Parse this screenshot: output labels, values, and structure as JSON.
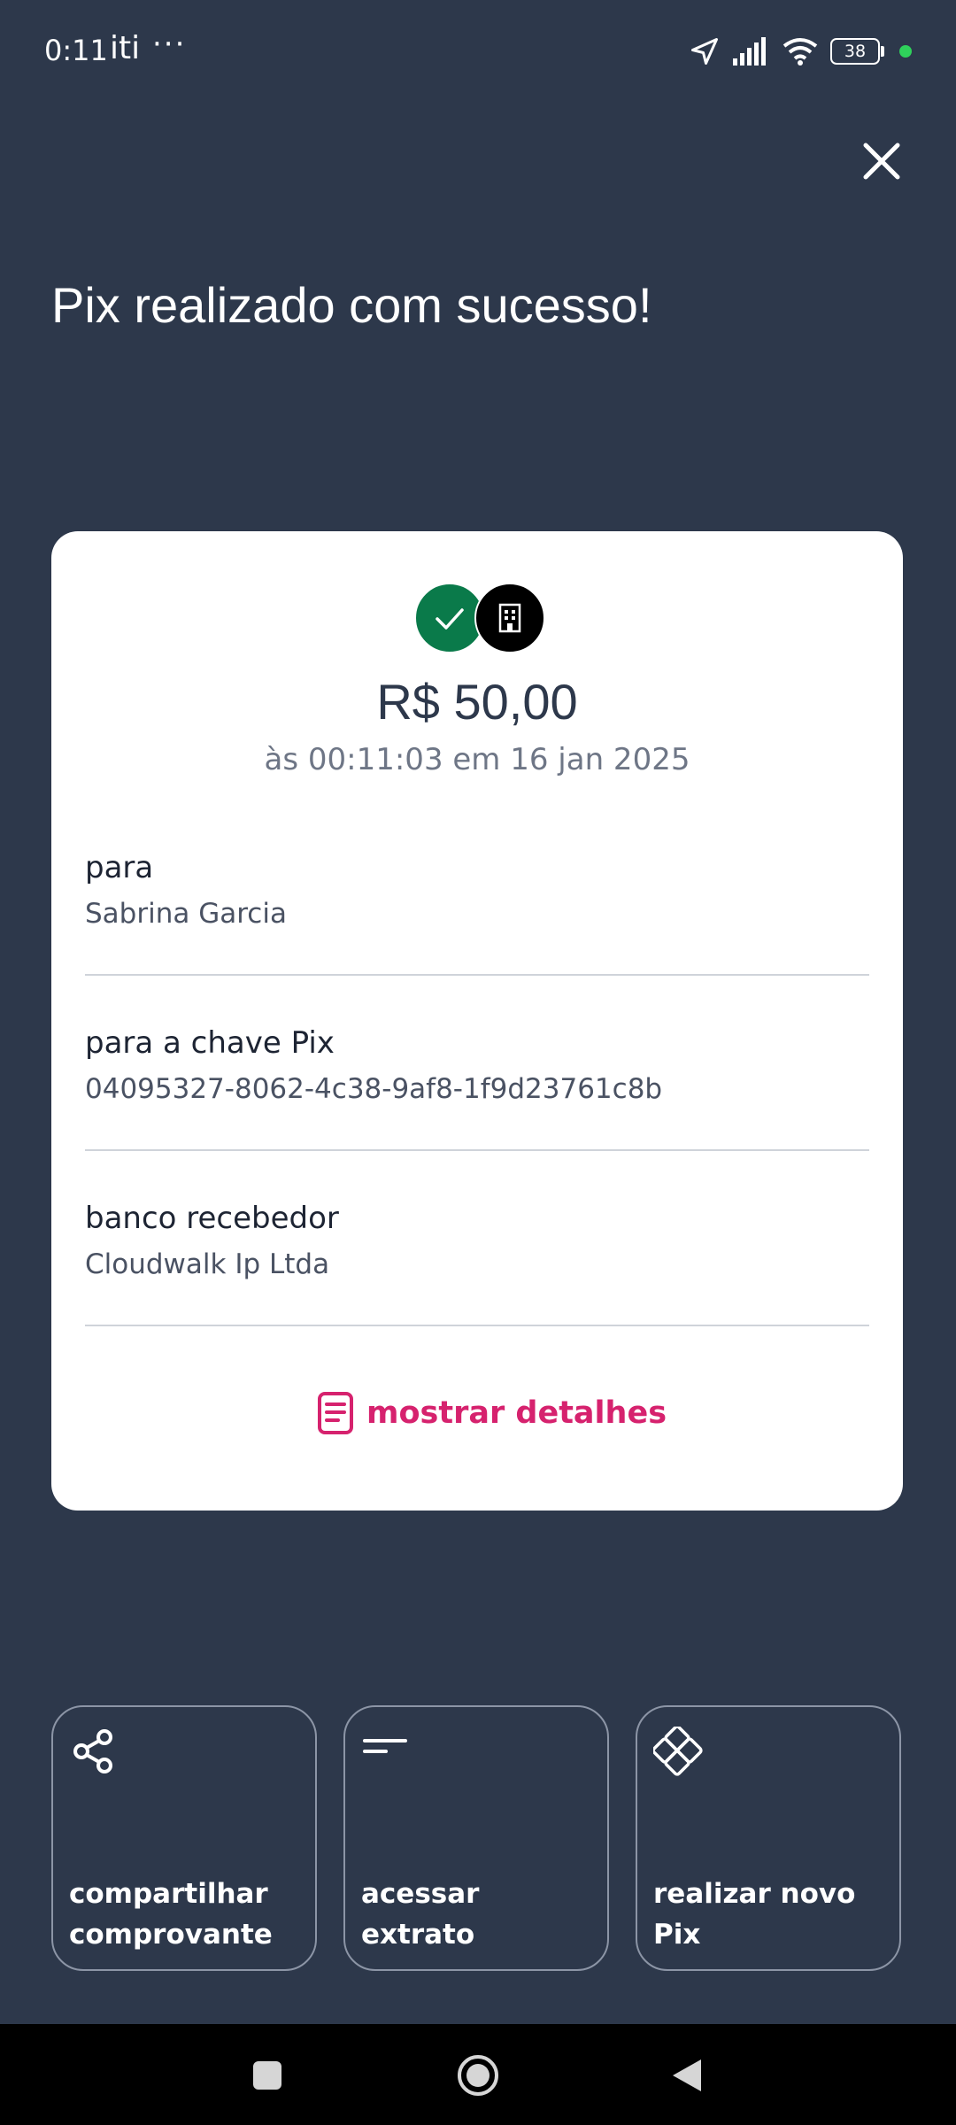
{
  "status_bar": {
    "time": "0:11",
    "app_label": "iti",
    "more_dots": "···",
    "battery_level": "38",
    "icons": [
      "location-arrow-icon",
      "signal-icon",
      "wifi-icon",
      "battery-icon",
      "green-dot-indicator"
    ]
  },
  "header": {
    "title": "Pix realizado com sucesso!",
    "close_icon": "close-icon"
  },
  "receipt": {
    "amount": "R$ 50,00",
    "datetime": "às 00:11:03 em 16 jan 2025",
    "details": [
      {
        "label": "para",
        "value": "Sabrina Garcia"
      },
      {
        "label": "para a chave Pix",
        "value": "04095327-8062-4c38-9af8-1f9d23761c8b"
      },
      {
        "label": "banco recebedor",
        "value": "Cloudwalk Ip Ltda"
      }
    ],
    "show_details_label": "mostrar detalhes"
  },
  "actions": [
    {
      "label": "compartilhar comprovante",
      "icon": "share-icon"
    },
    {
      "label": "acessar extrato",
      "icon": "statement-lines-icon"
    },
    {
      "label": "realizar novo Pix",
      "icon": "pix-icon"
    }
  ],
  "colors": {
    "background": "#2d384b",
    "card": "#ffffff",
    "accent": "#d6226e",
    "success": "#0a7a4a"
  }
}
